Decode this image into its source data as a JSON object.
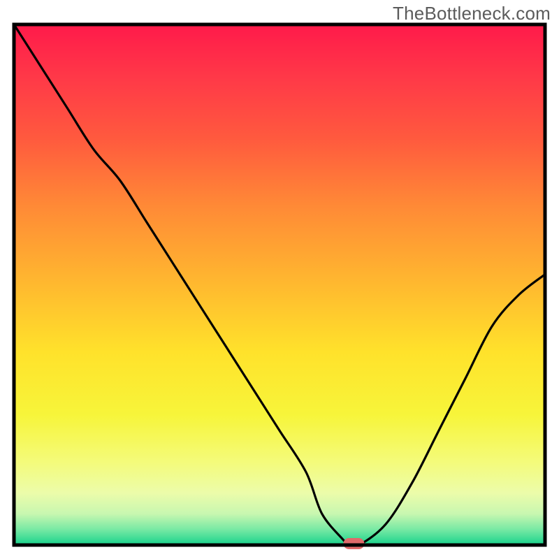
{
  "watermark": "TheBottleneck.com",
  "chart_data": {
    "type": "line",
    "title": "",
    "xlabel": "",
    "ylabel": "",
    "xlim": [
      0,
      100
    ],
    "ylim": [
      0,
      100
    ],
    "grid": false,
    "legend": false,
    "x": [
      0,
      5,
      10,
      15,
      20,
      25,
      30,
      35,
      40,
      45,
      50,
      55,
      58,
      62,
      63,
      65,
      70,
      75,
      80,
      85,
      90,
      95,
      100
    ],
    "values": [
      100,
      92,
      84,
      76,
      70,
      62,
      54,
      46,
      38,
      30,
      22,
      14,
      6,
      1,
      0,
      0,
      4,
      12,
      22,
      32,
      42,
      48,
      52
    ],
    "marker": {
      "x": 64,
      "y": 0,
      "color": "#e06a6a"
    }
  }
}
